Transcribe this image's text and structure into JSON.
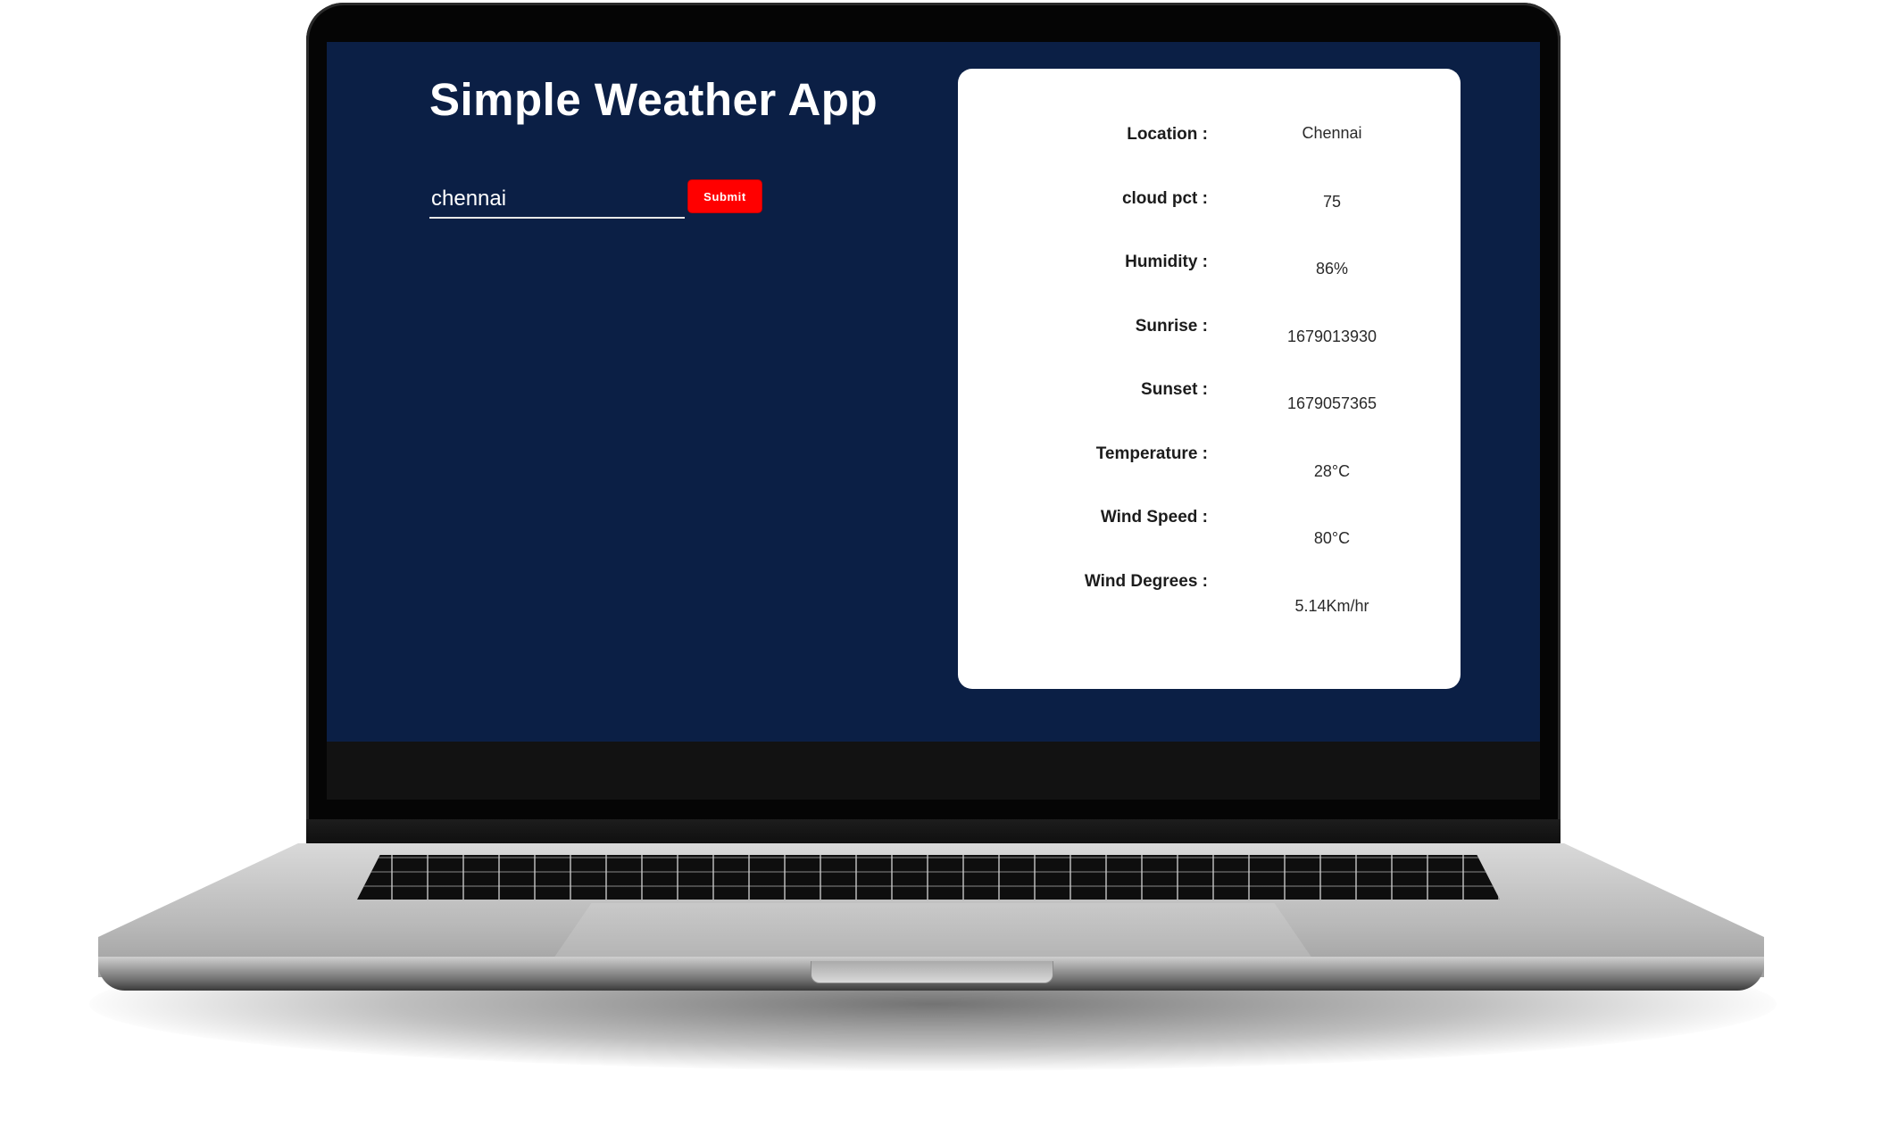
{
  "app": {
    "title": "Simple Weather App"
  },
  "search": {
    "value": "chennai",
    "submit_label": "Submit"
  },
  "weather": {
    "rows": [
      {
        "label": "Location :",
        "value": "Chennai"
      },
      {
        "label": "cloud pct :",
        "value": "75"
      },
      {
        "label": "Humidity :",
        "value": "86%"
      },
      {
        "label": "Sunrise :",
        "value": "1679013930"
      },
      {
        "label": "Sunset :",
        "value": "1679057365"
      },
      {
        "label": "Temperature :",
        "value": "28°C"
      },
      {
        "label": "Wind Speed :",
        "value": "80°C"
      },
      {
        "label": "Wind Degrees :",
        "value": "5.14Km/hr"
      }
    ]
  },
  "colors": {
    "screen_background": "#0b1f45",
    "card_background": "#ffffff",
    "submit_button": "#ff0000",
    "laptop_bezel": "#050505",
    "laptop_body": "#c0c0c0"
  },
  "icons": [
    "laptop-keyboard",
    "laptop-trackpad"
  ]
}
